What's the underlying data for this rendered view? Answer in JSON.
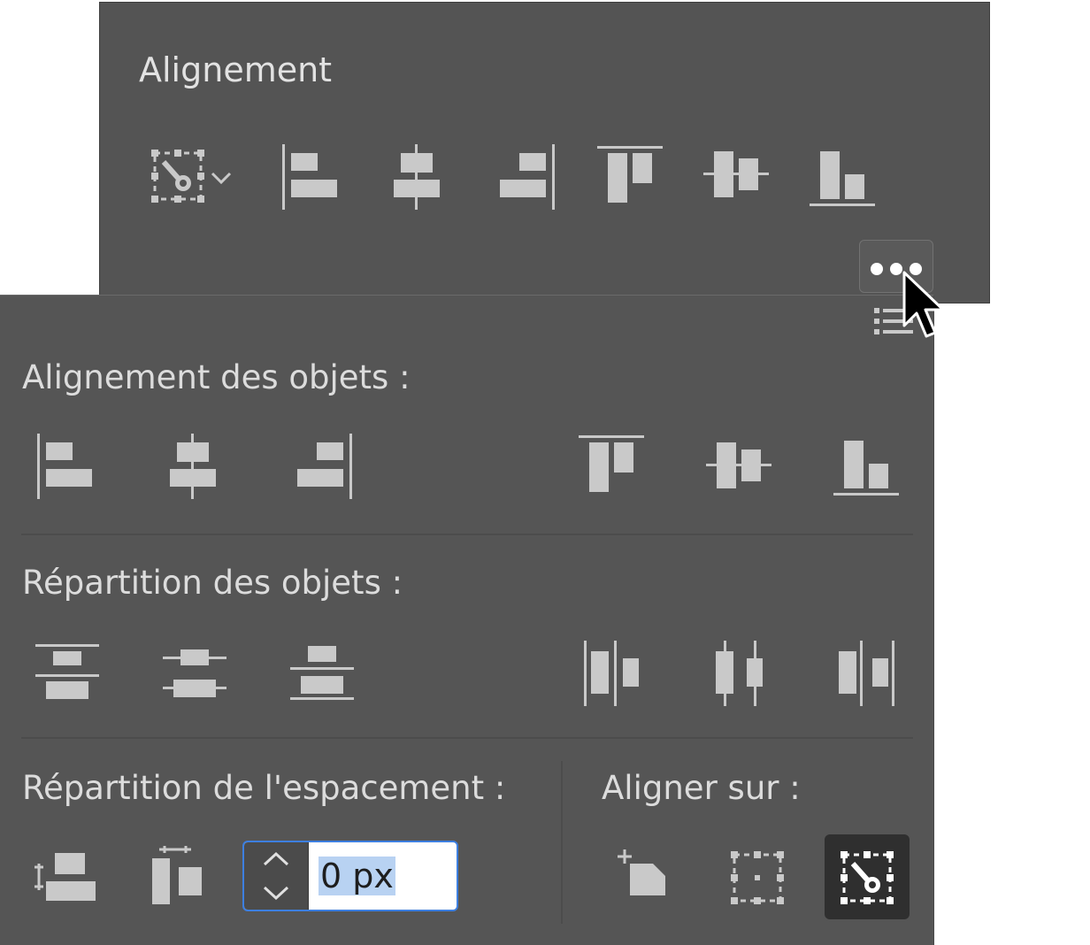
{
  "top_panel": {
    "title": "Alignement"
  },
  "object_alignment": {
    "label": "Alignement des objets :"
  },
  "object_distribution": {
    "label": "Répartition des objets :"
  },
  "spacing_distribution": {
    "label": "Répartition de l'espacement :",
    "spacing_value": "0 px"
  },
  "align_to": {
    "label": "Aligner sur :"
  },
  "icons": [
    "key-object-align-icon",
    "chevron-down-icon",
    "align-left-edge-icon",
    "align-horizontal-center-icon",
    "align-right-edge-icon",
    "align-top-edge-icon",
    "align-vertical-center-icon",
    "align-bottom-edge-icon",
    "more-options-icon",
    "panel-options-icon",
    "distribute-top-icon",
    "distribute-vertical-center-icon",
    "distribute-bottom-icon",
    "distribute-left-icon",
    "distribute-horizontal-center-icon",
    "distribute-right-icon",
    "vertical-spacing-icon",
    "horizontal-spacing-icon",
    "align-to-artboard-icon",
    "align-to-selection-icon",
    "align-to-key-object-icon",
    "cursor-pointer-icon"
  ],
  "colors": {
    "panel_bg": "#545454",
    "icon_fill": "#c9c9c9",
    "focus_ring": "#3d7fe0",
    "selected_bg": "#2f2f2f"
  }
}
